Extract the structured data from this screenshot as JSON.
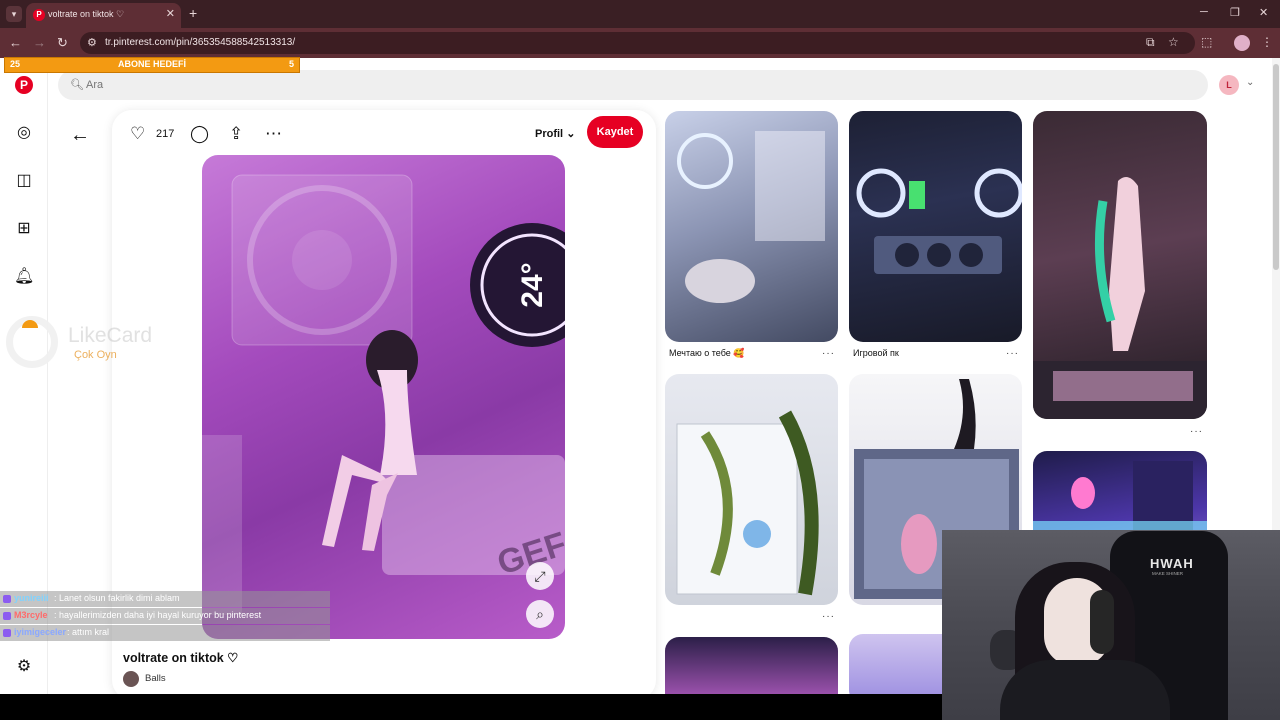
{
  "browser": {
    "tab_title": "voltrate on tiktok ♡",
    "url": "tr.pinterest.com/pin/365354588542513313/"
  },
  "overlay": {
    "goal_left": "25",
    "goal_label": "ABONE HEDEFİ",
    "goal_right": "5",
    "likecard_title": "LikeCard",
    "likecard_sub": "Çok Oyn"
  },
  "pinterest": {
    "search_placeholder": "Ara",
    "user_initial": "L",
    "like_count": "217",
    "profile_menu": "Profil",
    "save_label": "Kaydet",
    "pin_title": "voltrate on tiktok ♡",
    "creator": "Balls",
    "grid": [
      {
        "caption": "Мечтаю о тебе 🥰"
      },
      {
        "caption": "Игровой пк"
      },
      {
        "caption": ""
      },
      {
        "caption": ""
      },
      {
        "caption": ""
      },
      {
        "caption": ""
      }
    ]
  },
  "chat": [
    {
      "user": "yunireiii",
      "message": ": Lanet olsun fakirlik dimi ablam"
    },
    {
      "user": "M3rcyle",
      "message": ": hayallerimizden daha iyi hayal kuruyor bu pinterest"
    },
    {
      "user": "iyimigeceler",
      "message": ": attım kral"
    }
  ],
  "webcam": {
    "chair_brand": "HWAH",
    "chair_sub": "MAKE SHINER"
  },
  "colors": {
    "pinterest_red": "#e60023",
    "goal_orange": "#f39a12",
    "browser_dark": "#3a1f24"
  }
}
